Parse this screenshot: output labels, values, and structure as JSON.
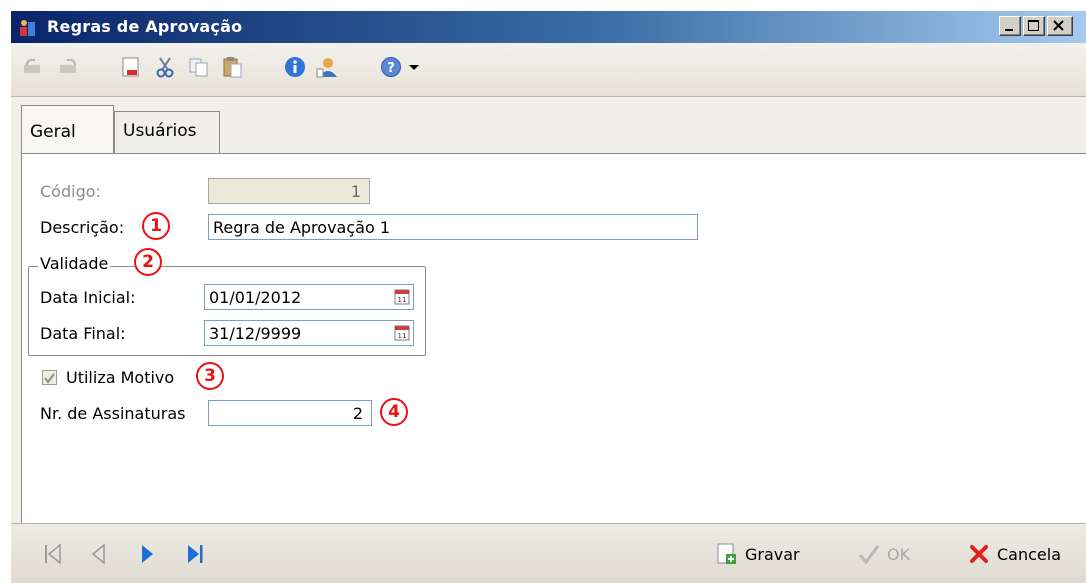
{
  "window": {
    "title": "Regras de Aprovação"
  },
  "toolbar": {
    "icons": [
      "undo-icon",
      "redo-icon",
      "new-document-icon",
      "cut-icon",
      "copy-icon",
      "paste-icon",
      "info-icon",
      "user-icon",
      "help-icon",
      "dropdown-arrow-icon"
    ]
  },
  "tabs": [
    {
      "label": "Geral",
      "active": true
    },
    {
      "label": "Usuários",
      "active": false
    }
  ],
  "form": {
    "codigo_label": "Código:",
    "codigo_value": "1",
    "descricao_label": "Descrição:",
    "descricao_value": "Regra de Aprovação 1",
    "validade_legend": "Validade",
    "data_inicial_label": "Data Inicial:",
    "data_inicial_value": "01/01/2012",
    "data_final_label": "Data Final:",
    "data_final_value": "31/12/9999",
    "utiliza_motivo_label": "Utiliza Motivo",
    "utiliza_motivo_checked": true,
    "assinaturas_label": "Nr. de Assinaturas",
    "assinaturas_value": "2"
  },
  "markers": [
    "1",
    "2",
    "3",
    "4"
  ],
  "footer": {
    "gravar_label": "Gravar",
    "ok_label": "OK",
    "cancela_label": "Cancela"
  },
  "colors": {
    "titlebar": "#0a246a",
    "marker": "#ee1111",
    "nav_blue": "#1e6fd8",
    "cancel_red": "#e02020"
  }
}
